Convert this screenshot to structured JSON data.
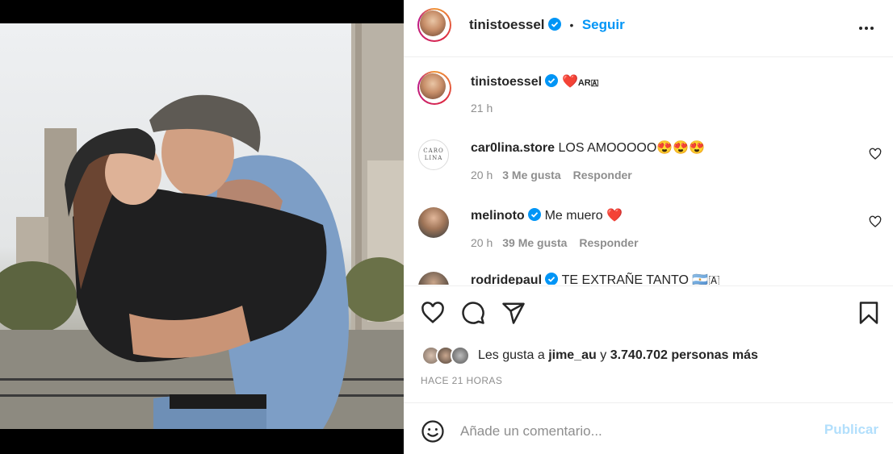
{
  "post": {
    "author": "tinistoessel",
    "verified": true,
    "follow_label": "Seguir",
    "separator": "•",
    "caption_emoji": "❤️",
    "caption_text": "AR🇦",
    "caption_time": "21 h"
  },
  "comments": [
    {
      "username": "car0lina.store",
      "text": "LOS AMOOOOO😍😍😍",
      "time": "20 h",
      "likes": "3 Me gusta",
      "reply": "Responder",
      "avatar_text": "CARO LINA"
    },
    {
      "username": "melinoto",
      "verified": true,
      "text": "Me muero ❤️",
      "time": "20 h",
      "likes": "39 Me gusta",
      "reply": "Responder"
    },
    {
      "username": "rodridepaul",
      "verified": true,
      "text": "TE EXTRAÑE TANTO 🇦🇷🇦"
    }
  ],
  "likes": {
    "prefix": "Les gusta a",
    "user": "jime_au",
    "middle": "y",
    "count": "3.740.702 personas más"
  },
  "time_ago": "HACE 21 HORAS",
  "add_comment": {
    "placeholder": "Añade un comentario...",
    "publish_label": "Publicar"
  },
  "colors": {
    "accent": "#0095f6",
    "publish_disabled": "#b2dffc",
    "text": "#262626",
    "muted": "#8e8e8e",
    "like_red": "#ed4956"
  },
  "icons": [
    "verified-badge-icon",
    "more-options-icon",
    "heart-icon",
    "comment-icon",
    "share-icon",
    "bookmark-icon",
    "emoji-icon"
  ]
}
